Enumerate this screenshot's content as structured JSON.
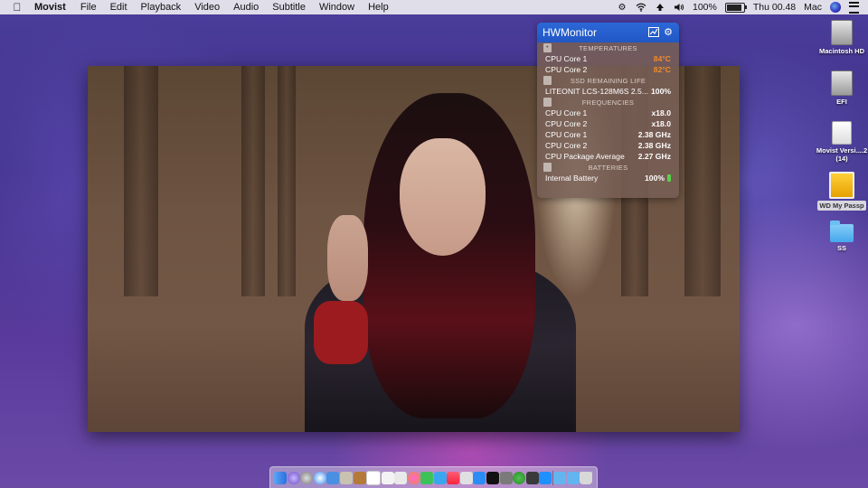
{
  "menubar": {
    "app_name": "Movist",
    "menus": [
      "File",
      "Edit",
      "Playback",
      "Video",
      "Audio",
      "Subtitle",
      "Window",
      "Help"
    ],
    "battery_percent": "100%",
    "battery_level": 1.0,
    "clock": "Thu 00.48",
    "user": "Mac",
    "status_icons": [
      "app-status-icon",
      "wifi-icon",
      "upload-icon",
      "volume-icon",
      "battery-icon",
      "siri-icon",
      "list-icon"
    ]
  },
  "hwmonitor": {
    "title": "HWMonitor",
    "sections": {
      "temperatures": "TEMPERATURES",
      "ssd": "SSD REMAINING LIFE",
      "frequencies": "FREQUENCIES",
      "batteries": "BATTERIES"
    },
    "temperatures": [
      {
        "label": "CPU Core 1",
        "value": "84°C"
      },
      {
        "label": "CPU Core 2",
        "value": "82°C"
      }
    ],
    "ssd": [
      {
        "label": "LITEONIT LCS-128M6S 2.5...",
        "value": "100%"
      }
    ],
    "frequencies": [
      {
        "label": "CPU Core 1",
        "value": "x18.0"
      },
      {
        "label": "CPU Core 2",
        "value": "x18.0"
      },
      {
        "label": "CPU Core 1",
        "value": "2.38 GHz"
      },
      {
        "label": "CPU Core 2",
        "value": "2.38 GHz"
      },
      {
        "label": "CPU Package Average",
        "value": "2.27 GHz"
      }
    ],
    "batteries": [
      {
        "label": "Internal Battery",
        "value": "100%"
      }
    ],
    "accent_color": "#2a63d3",
    "warning_color": "#f08a2c"
  },
  "desktop_icons": [
    {
      "label": "Macintosh HD"
    },
    {
      "label": "EFI"
    },
    {
      "label": "Movist Versi....2 (14)"
    },
    {
      "label": "WD My Passp"
    },
    {
      "label": "SS"
    }
  ]
}
